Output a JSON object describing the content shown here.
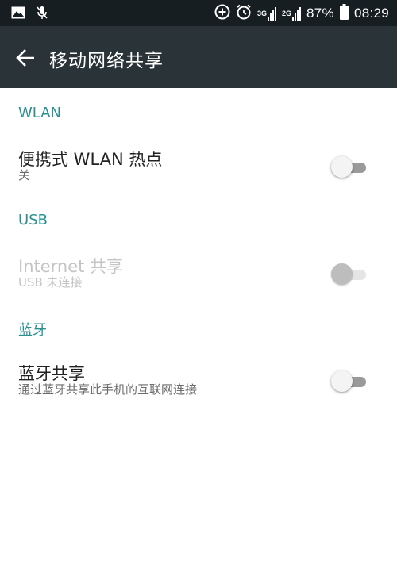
{
  "status_bar": {
    "network1": "3G",
    "network2": "2G",
    "battery_percent": "87%",
    "time": "08:29",
    "left_icons": [
      "image-icon",
      "mute-mic-icon"
    ],
    "right_icons": [
      "data-saver-icon",
      "alarm-icon",
      "signal-icon",
      "battery-icon"
    ]
  },
  "toolbar": {
    "title": "移动网络共享",
    "back_icon": "arrow-left-icon"
  },
  "sections": {
    "wlan": {
      "header": "WLAN",
      "item_title": "便携式 WLAN 热点",
      "item_subtitle": "关",
      "toggle_on": false,
      "enabled": true
    },
    "usb": {
      "header": "USB",
      "item_title": "Internet 共享",
      "item_subtitle": "USB 未连接",
      "toggle_on": false,
      "enabled": false
    },
    "bluetooth": {
      "header": "蓝牙",
      "item_title": "蓝牙共享",
      "item_subtitle": "通过蓝牙共享此手机的互联网连接",
      "toggle_on": false,
      "enabled": true
    }
  },
  "colors": {
    "status_bar_bg": "#161e22",
    "toolbar_bg": "#2a3337",
    "section_header": "#2a8f8f",
    "primary_text": "#222222",
    "secondary_text": "#6b6b6b",
    "disabled_text": "#c4c4c4"
  }
}
